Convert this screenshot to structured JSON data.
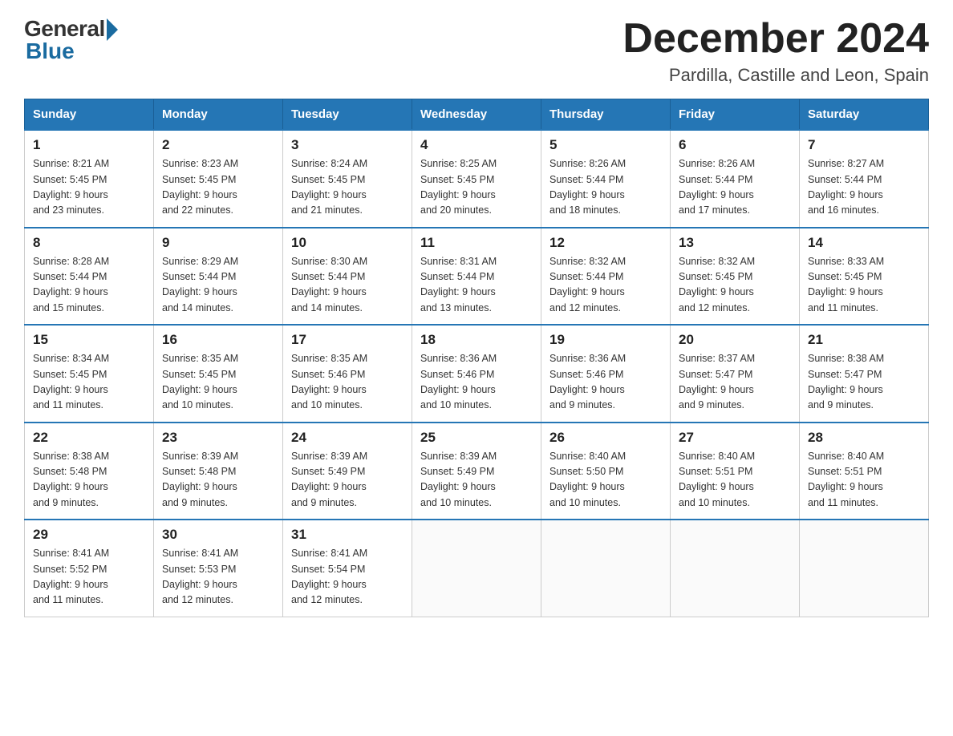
{
  "logo": {
    "general": "General",
    "blue": "Blue"
  },
  "title": "December 2024",
  "subtitle": "Pardilla, Castille and Leon, Spain",
  "days_of_week": [
    "Sunday",
    "Monday",
    "Tuesday",
    "Wednesday",
    "Thursday",
    "Friday",
    "Saturday"
  ],
  "weeks": [
    [
      {
        "day": "1",
        "sunrise": "8:21 AM",
        "sunset": "5:45 PM",
        "daylight": "9 hours and 23 minutes."
      },
      {
        "day": "2",
        "sunrise": "8:23 AM",
        "sunset": "5:45 PM",
        "daylight": "9 hours and 22 minutes."
      },
      {
        "day": "3",
        "sunrise": "8:24 AM",
        "sunset": "5:45 PM",
        "daylight": "9 hours and 21 minutes."
      },
      {
        "day": "4",
        "sunrise": "8:25 AM",
        "sunset": "5:45 PM",
        "daylight": "9 hours and 20 minutes."
      },
      {
        "day": "5",
        "sunrise": "8:26 AM",
        "sunset": "5:44 PM",
        "daylight": "9 hours and 18 minutes."
      },
      {
        "day": "6",
        "sunrise": "8:26 AM",
        "sunset": "5:44 PM",
        "daylight": "9 hours and 17 minutes."
      },
      {
        "day": "7",
        "sunrise": "8:27 AM",
        "sunset": "5:44 PM",
        "daylight": "9 hours and 16 minutes."
      }
    ],
    [
      {
        "day": "8",
        "sunrise": "8:28 AM",
        "sunset": "5:44 PM",
        "daylight": "9 hours and 15 minutes."
      },
      {
        "day": "9",
        "sunrise": "8:29 AM",
        "sunset": "5:44 PM",
        "daylight": "9 hours and 14 minutes."
      },
      {
        "day": "10",
        "sunrise": "8:30 AM",
        "sunset": "5:44 PM",
        "daylight": "9 hours and 14 minutes."
      },
      {
        "day": "11",
        "sunrise": "8:31 AM",
        "sunset": "5:44 PM",
        "daylight": "9 hours and 13 minutes."
      },
      {
        "day": "12",
        "sunrise": "8:32 AM",
        "sunset": "5:44 PM",
        "daylight": "9 hours and 12 minutes."
      },
      {
        "day": "13",
        "sunrise": "8:32 AM",
        "sunset": "5:45 PM",
        "daylight": "9 hours and 12 minutes."
      },
      {
        "day": "14",
        "sunrise": "8:33 AM",
        "sunset": "5:45 PM",
        "daylight": "9 hours and 11 minutes."
      }
    ],
    [
      {
        "day": "15",
        "sunrise": "8:34 AM",
        "sunset": "5:45 PM",
        "daylight": "9 hours and 11 minutes."
      },
      {
        "day": "16",
        "sunrise": "8:35 AM",
        "sunset": "5:45 PM",
        "daylight": "9 hours and 10 minutes."
      },
      {
        "day": "17",
        "sunrise": "8:35 AM",
        "sunset": "5:46 PM",
        "daylight": "9 hours and 10 minutes."
      },
      {
        "day": "18",
        "sunrise": "8:36 AM",
        "sunset": "5:46 PM",
        "daylight": "9 hours and 10 minutes."
      },
      {
        "day": "19",
        "sunrise": "8:36 AM",
        "sunset": "5:46 PM",
        "daylight": "9 hours and 9 minutes."
      },
      {
        "day": "20",
        "sunrise": "8:37 AM",
        "sunset": "5:47 PM",
        "daylight": "9 hours and 9 minutes."
      },
      {
        "day": "21",
        "sunrise": "8:38 AM",
        "sunset": "5:47 PM",
        "daylight": "9 hours and 9 minutes."
      }
    ],
    [
      {
        "day": "22",
        "sunrise": "8:38 AM",
        "sunset": "5:48 PM",
        "daylight": "9 hours and 9 minutes."
      },
      {
        "day": "23",
        "sunrise": "8:39 AM",
        "sunset": "5:48 PM",
        "daylight": "9 hours and 9 minutes."
      },
      {
        "day": "24",
        "sunrise": "8:39 AM",
        "sunset": "5:49 PM",
        "daylight": "9 hours and 9 minutes."
      },
      {
        "day": "25",
        "sunrise": "8:39 AM",
        "sunset": "5:49 PM",
        "daylight": "9 hours and 10 minutes."
      },
      {
        "day": "26",
        "sunrise": "8:40 AM",
        "sunset": "5:50 PM",
        "daylight": "9 hours and 10 minutes."
      },
      {
        "day": "27",
        "sunrise": "8:40 AM",
        "sunset": "5:51 PM",
        "daylight": "9 hours and 10 minutes."
      },
      {
        "day": "28",
        "sunrise": "8:40 AM",
        "sunset": "5:51 PM",
        "daylight": "9 hours and 11 minutes."
      }
    ],
    [
      {
        "day": "29",
        "sunrise": "8:41 AM",
        "sunset": "5:52 PM",
        "daylight": "9 hours and 11 minutes."
      },
      {
        "day": "30",
        "sunrise": "8:41 AM",
        "sunset": "5:53 PM",
        "daylight": "9 hours and 12 minutes."
      },
      {
        "day": "31",
        "sunrise": "8:41 AM",
        "sunset": "5:54 PM",
        "daylight": "9 hours and 12 minutes."
      },
      null,
      null,
      null,
      null
    ]
  ],
  "labels": {
    "sunrise": "Sunrise:",
    "sunset": "Sunset:",
    "daylight": "Daylight:"
  }
}
